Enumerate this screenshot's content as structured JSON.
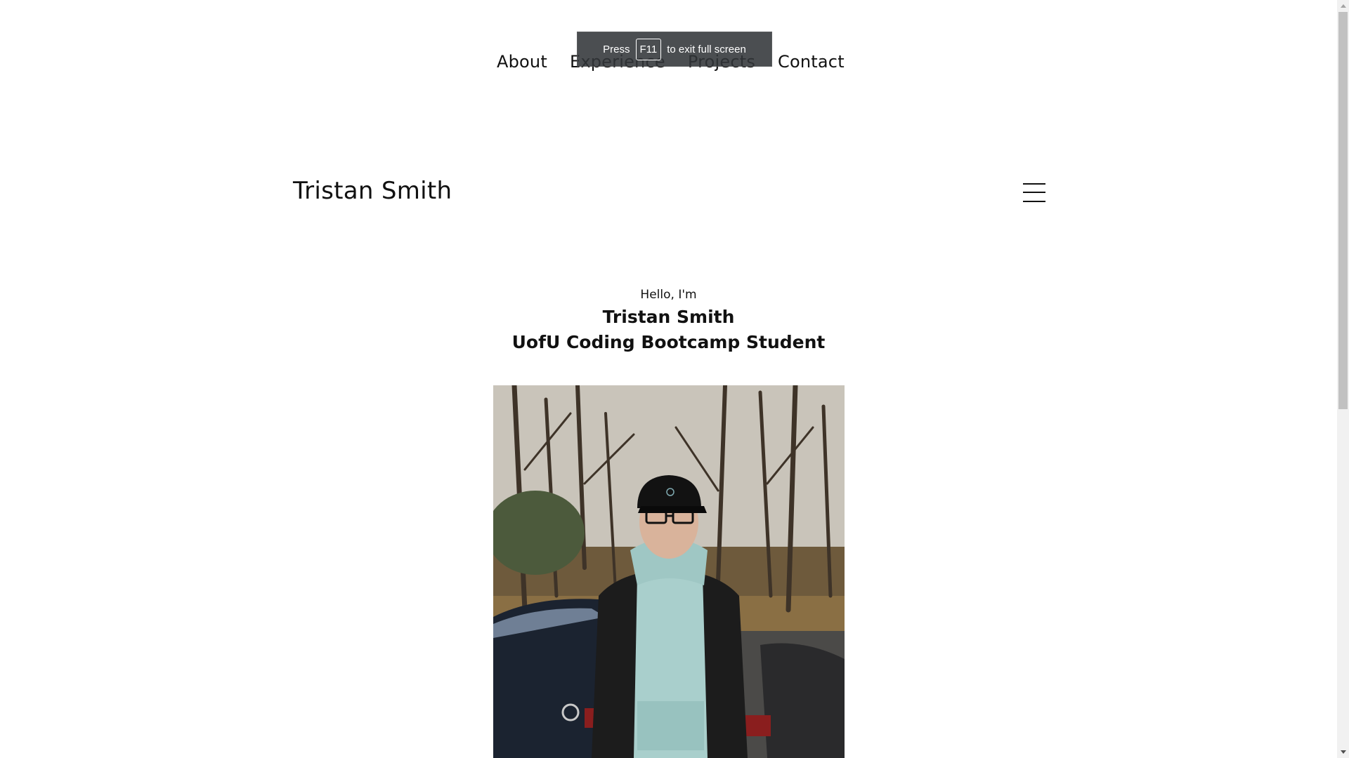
{
  "nav": {
    "items": [
      "About",
      "Experience",
      "Projects",
      "Contact"
    ]
  },
  "fullscreen_toast": {
    "press": "Press",
    "key": "F11",
    "suffix": "to exit full screen"
  },
  "header": {
    "brand": "Tristan Smith",
    "menu_icon": "hamburger-menu-icon"
  },
  "hero": {
    "greeting": "Hello, I'm",
    "name": "Tristan Smith",
    "role": "UofU Coding Bootcamp Student"
  },
  "colors": {
    "text": "#111111",
    "background": "#ffffff",
    "toast_bg": "#323639"
  }
}
